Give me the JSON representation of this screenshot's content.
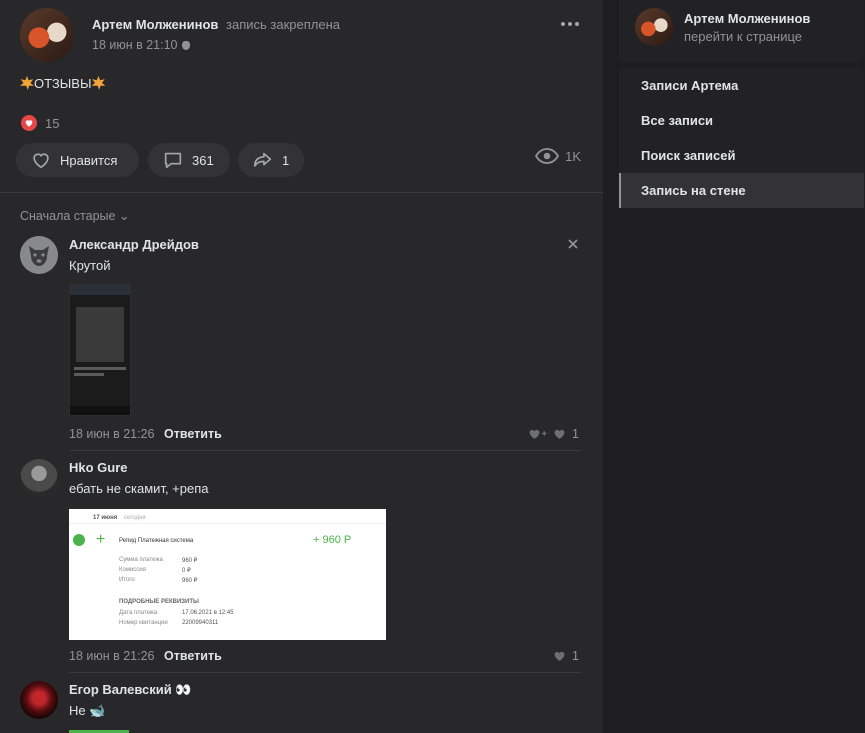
{
  "post": {
    "author": "Артем Молженинов",
    "pinned_label": "запись закреплена",
    "date": "18 июн в 21:10",
    "text": "ОТЗЫВЫ",
    "reactions_count": "15",
    "like_label": "Нравится",
    "comments_count": "361",
    "shares_count": "1",
    "views_count": "1K"
  },
  "comments_sort": "Сначала старые",
  "comments": [
    {
      "author": "Александр Дрейдов",
      "text": "Крутой",
      "date": "18 июн в 21:26",
      "reply_label": "Ответить",
      "likes": "1"
    },
    {
      "author": "Hko Gure",
      "text": "ебать не скамит, +репа",
      "date": "18 июн в 21:26",
      "reply_label": "Ответить",
      "likes": "1"
    },
    {
      "author": "Егор Валевский 👀",
      "text": "Не 🐋"
    }
  ],
  "receipt": {
    "date_label": "17 июня",
    "today_label": "сегодня",
    "title": "Репид Платежная система",
    "amount": "+ 960 Р",
    "rows": [
      {
        "k": "Сумма платежа",
        "v": "960 ₽"
      },
      {
        "k": "Комиссия",
        "v": "0 ₽"
      },
      {
        "k": "Итого",
        "v": "960 ₽"
      }
    ],
    "details_label": "ПОДРОБНЫЕ РЕКВИЗИТЫ",
    "detail_rows": [
      {
        "k": "Дата платежа",
        "v": "17.06.2021 в 12:45"
      },
      {
        "k": "Номер квитанции",
        "v": "22009940311"
      }
    ]
  },
  "sidebar": {
    "name": "Артем Молженинов",
    "sub": "перейти к странице",
    "items": [
      {
        "label": "Записи Артема"
      },
      {
        "label": "Все записи"
      },
      {
        "label": "Поиск записей"
      },
      {
        "label": "Запись на стене"
      }
    ]
  },
  "colors": {
    "background": "#28282a",
    "accent_green": "#4bb34b",
    "heart_red": "#e64646"
  }
}
